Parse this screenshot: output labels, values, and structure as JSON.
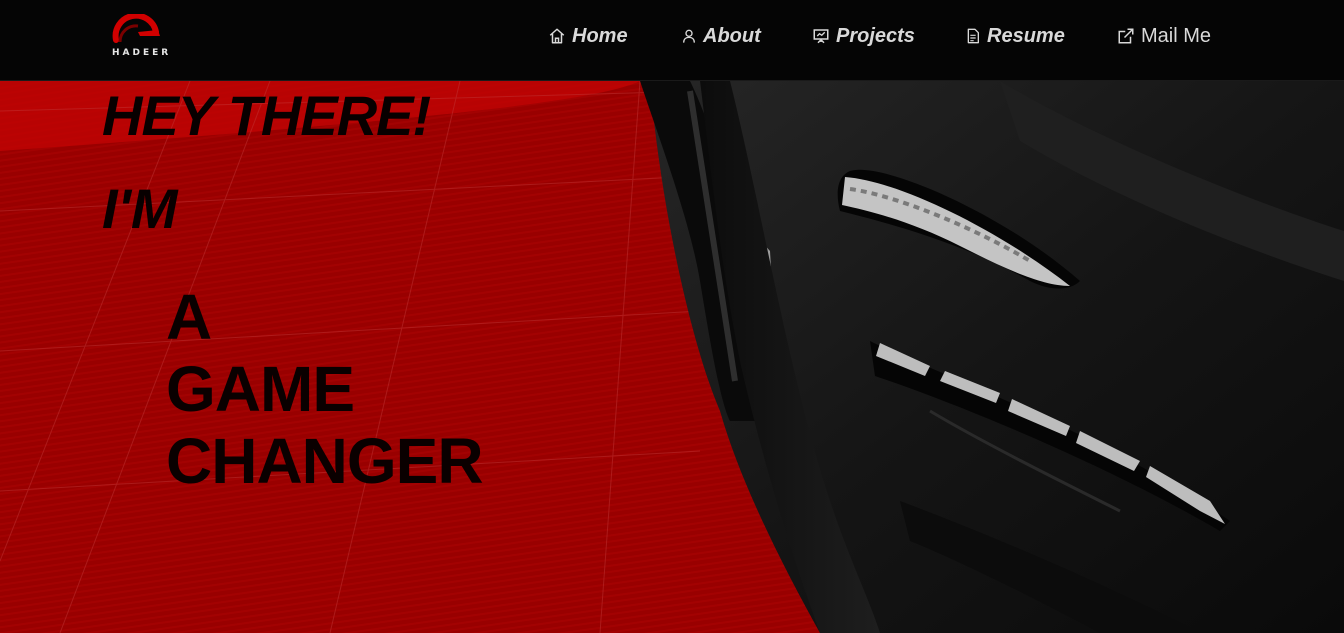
{
  "brand": {
    "logo_text": "HADEER",
    "accent": "#d10000"
  },
  "nav": {
    "items": [
      {
        "label": "Home",
        "icon": "home-icon"
      },
      {
        "label": "About",
        "icon": "user-icon"
      },
      {
        "label": "Projects",
        "icon": "presentation-icon"
      },
      {
        "label": "Resume",
        "icon": "document-icon"
      },
      {
        "label": "Mail Me",
        "icon": "external-link-icon"
      }
    ]
  },
  "hero": {
    "greeting": "HEY THERE!",
    "intro": "I'M",
    "tagline": [
      "A",
      "GAME",
      "CHANGER"
    ],
    "background_color": "#9a0000"
  }
}
